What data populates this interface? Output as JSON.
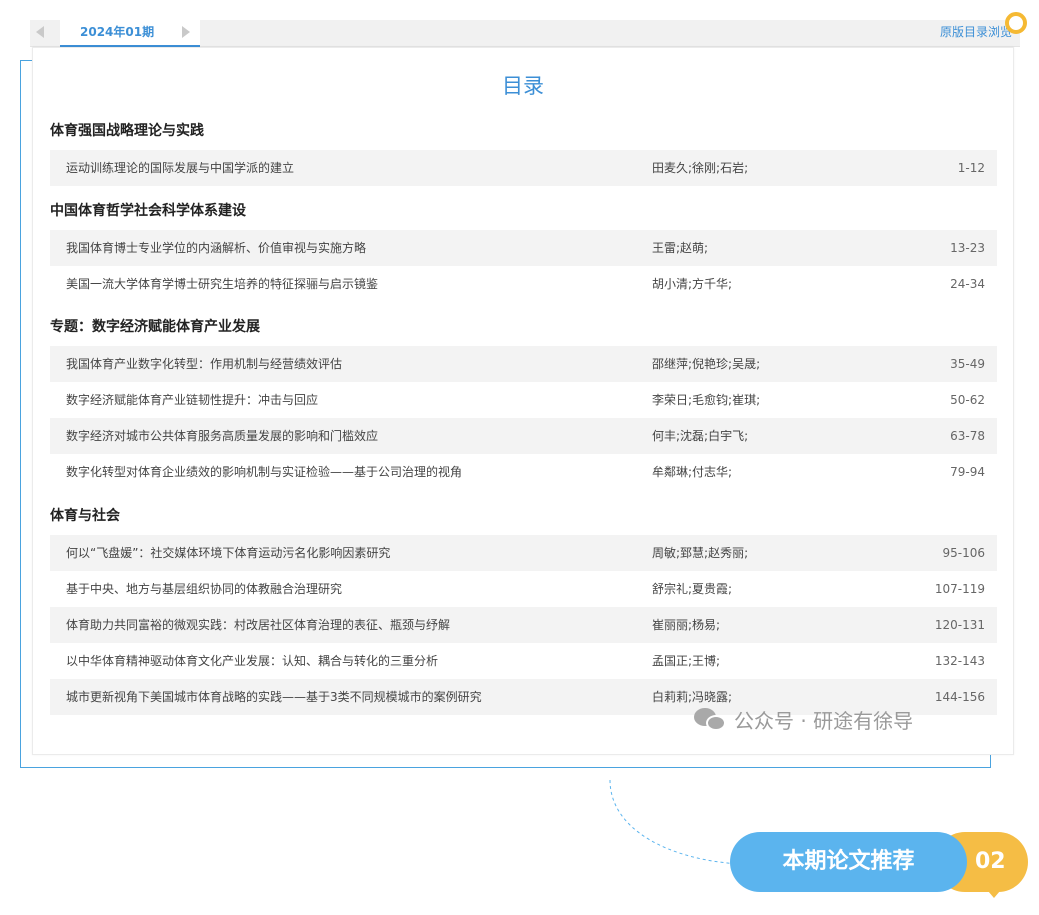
{
  "tab_bar": {
    "active_issue": "2024年01期",
    "catalog_link": "原版目录浏览"
  },
  "card": {
    "title": "目录"
  },
  "sections": [
    {
      "heading": "体育强国战略理论与实践",
      "rows": [
        {
          "title": "运动训练理论的国际发展与中国学派的建立",
          "authors": "田麦久;徐刚;石岩;",
          "pages": "1-12"
        }
      ]
    },
    {
      "heading": "中国体育哲学社会科学体系建设",
      "rows": [
        {
          "title": "我国体育博士专业学位的内涵解析、价值审视与实施方略",
          "authors": "王雷;赵萌;",
          "pages": "13-23"
        },
        {
          "title": "美国一流大学体育学博士研究生培养的特征探骊与启示镜鉴",
          "authors": "胡小清;方千华;",
          "pages": "24-34"
        }
      ]
    },
    {
      "heading": "专题：数字经济赋能体育产业发展",
      "rows": [
        {
          "title": "我国体育产业数字化转型：作用机制与经营绩效评估",
          "authors": "邵继萍;倪艳珍;吴晟;",
          "pages": "35-49"
        },
        {
          "title": "数字经济赋能体育产业链韧性提升：冲击与回应",
          "authors": "李荣日;毛愈钧;崔琪;",
          "pages": "50-62"
        },
        {
          "title": "数字经济对城市公共体育服务高质量发展的影响和门槛效应",
          "authors": "何丰;沈磊;白宇飞;",
          "pages": "63-78"
        },
        {
          "title": "数字化转型对体育企业绩效的影响机制与实证检验——基于公司治理的视角",
          "authors": "牟鄰琳;付志华;",
          "pages": "79-94"
        }
      ]
    },
    {
      "heading": "体育与社会",
      "rows": [
        {
          "title": "何以“飞盘媛”：社交媒体环境下体育运动污名化影响因素研究",
          "authors": "周敏;郅慧;赵秀丽;",
          "pages": "95-106"
        },
        {
          "title": "基于中央、地方与基层组织协同的体教融合治理研究",
          "authors": "舒宗礼;夏贵霞;",
          "pages": "107-119"
        },
        {
          "title": "体育助力共同富裕的微观实践：村改居社区体育治理的表征、瓶颈与纾解",
          "authors": "崔丽丽;杨易;",
          "pages": "120-131"
        },
        {
          "title": "以中华体育精神驱动体育文化产业发展：认知、耦合与转化的三重分析",
          "authors": "孟国正;王博;",
          "pages": "132-143"
        },
        {
          "title": "城市更新视角下美国城市体育战略的实践——基于3类不同规模城市的案例研究",
          "authors": "白莉莉;冯晓露;",
          "pages": "144-156"
        }
      ]
    }
  ],
  "watermark": {
    "text": "公众号 · 研途有徐导"
  },
  "badge": {
    "label": "本期论文推荐",
    "number": "02"
  },
  "colors": {
    "accent_blue": "#3c8fd6",
    "badge_blue": "#5bb4ee",
    "badge_yellow": "#f5bd45",
    "row_shade": "#f3f3f3"
  }
}
